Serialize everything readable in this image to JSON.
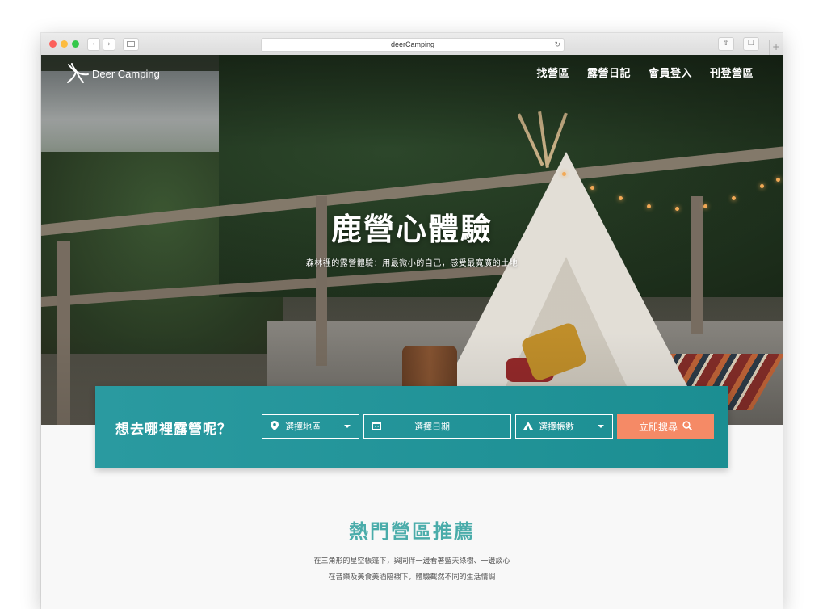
{
  "browser": {
    "url": "deerCamping"
  },
  "header": {
    "logo_text": "Deer Camping",
    "nav": [
      "找營區",
      "露營日記",
      "會員登入",
      "刊登營區"
    ]
  },
  "hero": {
    "title": "鹿營心體驗",
    "subtitle": "森林裡的露營體驗：用最微小的自己，感受最寬廣的土地"
  },
  "search": {
    "label": "想去哪裡露營呢？",
    "region_placeholder": "選擇地區",
    "date_placeholder": "選擇日期",
    "tents_placeholder": "選擇帳數",
    "submit_label": "立即搜尋"
  },
  "recommend": {
    "title": "熱門營區推薦",
    "desc_line1": "在三角形的星空帳篷下，與同伴一邊看著藍天綠樹、一邊談心",
    "desc_line2": "在音樂及美食美酒陪襯下，體驗截然不同的生活情調"
  },
  "colors": {
    "teal": "#1b8e92",
    "accent_orange": "#f58a66",
    "title_teal": "#4aacaa"
  },
  "icons": {
    "region": "map-pin-icon",
    "date": "calendar-icon",
    "tents": "tent-icon",
    "submit": "search-icon"
  }
}
